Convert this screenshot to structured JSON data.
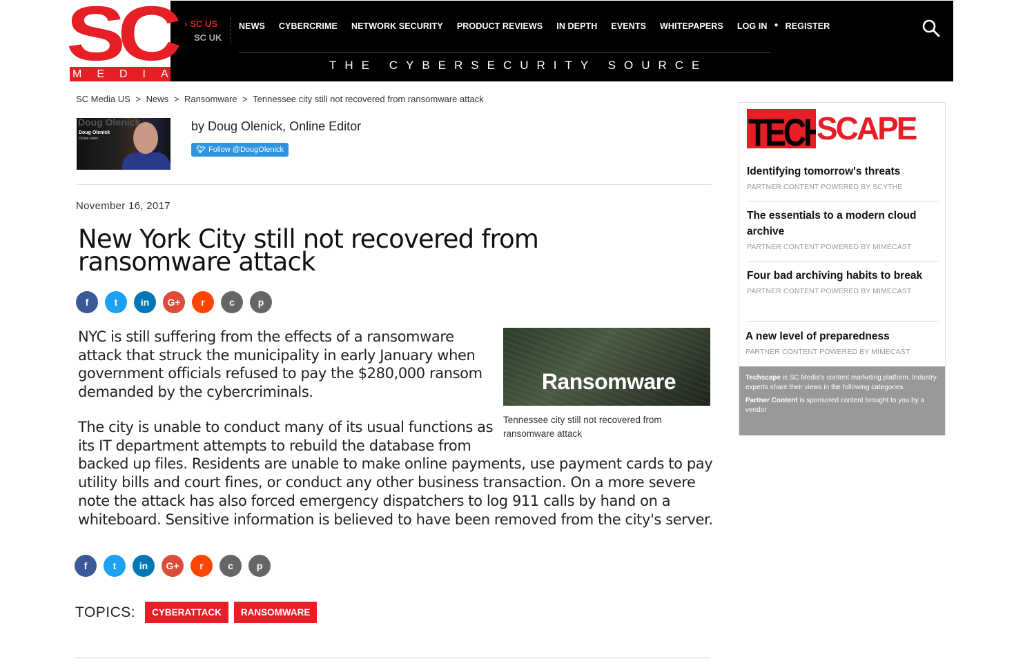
{
  "header": {
    "logo_sc": "SC",
    "logo_media": "MEDIA",
    "region_us": "SC US",
    "region_uk": "SC UK",
    "nav": [
      "NEWS",
      "CYBERCRIME",
      "NETWORK SECURITY",
      "PRODUCT REVIEWS",
      "IN DEPTH",
      "EVENTS",
      "WHITEPAPERS"
    ],
    "login": "LOG IN",
    "register": "REGISTER",
    "tagline": "THE CYBERSECURITY SOURCE"
  },
  "breadcrumb": [
    "SC Media US",
    ">",
    "News",
    ">",
    "Ransomware",
    ">",
    "Tennessee city still not recovered from ransomware attack"
  ],
  "author": {
    "photo_name": "Doug Olenick",
    "photo_title": "Online editor",
    "photo_bg": "Doug Olenick",
    "byline": "by Doug Olenick, Online Editor",
    "twitter": "Follow @DougOlenick"
  },
  "article": {
    "date": "November 16, 2017",
    "headline": "New York City still not recovered from ransomware attack",
    "p1": "NYC is still suffering from the effects of a ransomware attack that struck the municipality in early January when government officials refused to pay the $280,000 ransom demanded by the cybercriminals.",
    "p2_a": "The city is unable to conduct many of its usual functions as",
    "p2_b": "its IT department attempts to rebuild the database from",
    "p2_c": "backed up files.   Residents are unable to make online payments, use payment cards to pay utility bills and court fines, or conduct any other business transaction. On a more severe note the attack has also forced emergency dispatchers to log 911 calls by hand on a whiteboard. Sensitive information is believed to have been removed from the city's server.",
    "image_text": "Ransomware",
    "caption": "Tennessee city still not recovered from ransomware attack"
  },
  "share_icons": [
    "f",
    "t",
    "in",
    "G+",
    "r",
    "c",
    "p"
  ],
  "topics": {
    "label": "TOPICS:",
    "tags": [
      "CYBERATTACK",
      "RANSOMWARE"
    ]
  },
  "sidebar": {
    "logo_tech": "TECH",
    "logo_scape": "SCAPE",
    "items": [
      {
        "title": "Identifying tomorrow's threats",
        "sub": "PARTNER CONTENT POWERED BY SCYTHE"
      },
      {
        "title": "The essentials to a modern cloud archive",
        "sub": "PARTNER CONTENT POWERED BY MIMECAST"
      },
      {
        "title": "Four bad archiving habits to break",
        "sub": "PARTNER CONTENT POWERED BY MIMECAST"
      },
      {
        "title": "A new level of preparedness",
        "sub": "PARTNER CONTENT POWERED BY MIMECAST"
      }
    ],
    "footer_1_bold": "Techscape",
    "footer_1": " is SC Media's content marketing platform. Industry experts share their views in the following categories",
    "footer_2_bold": "Partner Content",
    "footer_2": " is sponsored content brought to you by a vendor"
  },
  "colors": {
    "brand_red": "#e61e26",
    "header_bg": "#000000",
    "twitter": "#2b95e0"
  }
}
